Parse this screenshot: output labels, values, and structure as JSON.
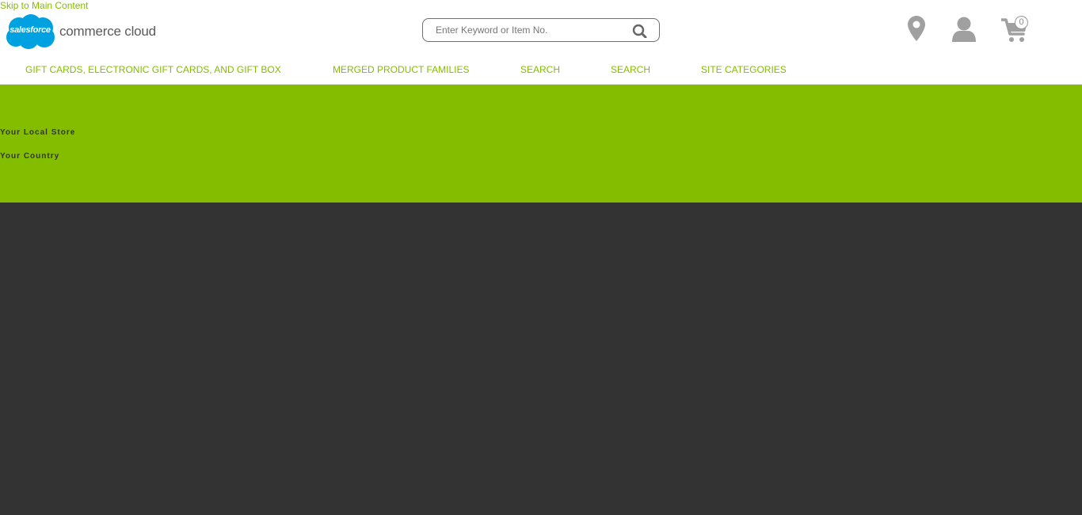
{
  "skip_link": "Skip to Main Content",
  "logo": {
    "cloud_text": "salesforce",
    "word": "commerce cloud"
  },
  "search": {
    "placeholder": "Enter Keyword or Item No.",
    "value": ""
  },
  "header_icons": [
    "map-pin-icon",
    "user-icon",
    "cart-icon"
  ],
  "cart": {
    "count": "0"
  },
  "nav": {
    "items": [
      {
        "label": "GIFT CARDS, ELECTRONIC GIFT CARDS, AND GIFT BOX"
      },
      {
        "label": "MERGED PRODUCT FAMILIES"
      },
      {
        "label": "SEARCH"
      },
      {
        "label": "SEARCH"
      },
      {
        "label": "SITE CATEGORIES"
      }
    ]
  },
  "banner": {
    "local_store": "Your Local Store",
    "country": "Your Country"
  },
  "colors": {
    "accent": "#84bd00",
    "brand_cloud": "#00a1e0",
    "dark_footer": "#333333",
    "icon_gray": "#a0a0a0"
  }
}
